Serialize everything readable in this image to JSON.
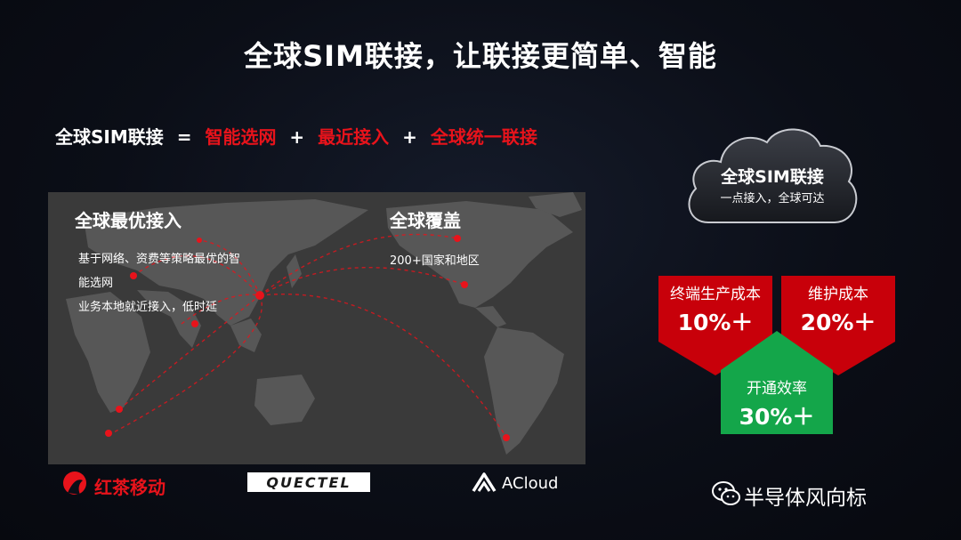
{
  "slide": {
    "title": "全球SIM联接，让联接更简单、智能"
  },
  "formula": {
    "left": "全球SIM联接",
    "equals": "=",
    "plus": "+",
    "part1": "智能选网",
    "part2": "最近接入",
    "part3": "全球统一联接"
  },
  "map": {
    "left_heading": "全球最优接入",
    "left_lines": [
      "基于网络、资费等策略最优的智",
      "能选网",
      "业务本地就近接入，低时延"
    ],
    "right_heading": "全球覆盖",
    "right_line": "200+国家和地区"
  },
  "cloud": {
    "title": "全球SIM联接",
    "subtitle": "一点接入，全球可达"
  },
  "benefits": [
    {
      "label": "终端生产成本",
      "value": "10%＋",
      "color": "#c8000a"
    },
    {
      "label": "维护成本",
      "value": "20%＋",
      "color": "#c8000a"
    },
    {
      "label": "开通效率",
      "value": "30%＋",
      "color": "#14a64a"
    }
  ],
  "logos": {
    "redtea": "红茶移动",
    "quectel": "QUECTEL",
    "acloud": "ACloud"
  },
  "watermark": {
    "text": "半导体风向标"
  }
}
